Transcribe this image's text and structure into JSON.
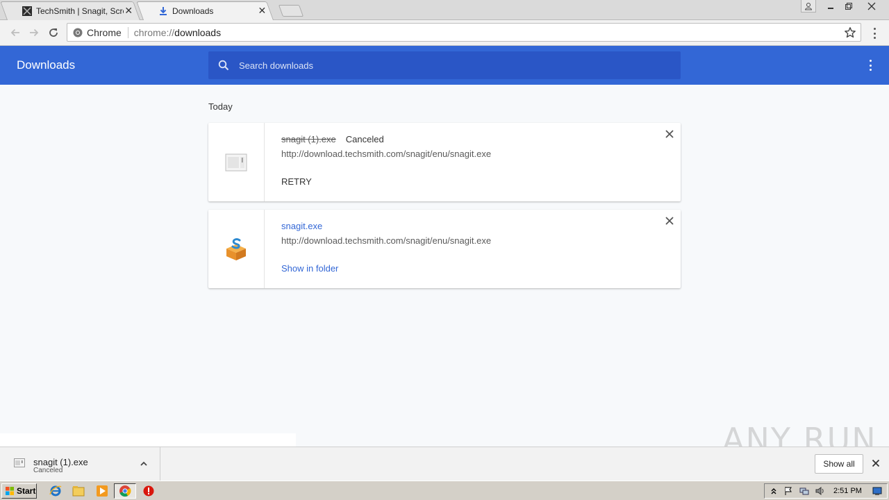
{
  "tabs": [
    {
      "title": "TechSmith | Snagit, Screen C",
      "active": false
    },
    {
      "title": "Downloads",
      "active": true
    }
  ],
  "toolbar": {
    "chip_label": "Chrome",
    "url_scheme": "chrome://",
    "url_host": "downloads"
  },
  "header": {
    "title": "Downloads",
    "search_placeholder": "Search downloads"
  },
  "section": {
    "label": "Today"
  },
  "downloads": [
    {
      "filename": "snagit (1).exe",
      "status": "Canceled",
      "url": "http://download.techsmith.com/snagit/enu/snagit.exe",
      "action": "RETRY"
    },
    {
      "filename": "snagit.exe",
      "status": "",
      "url": "http://download.techsmith.com/snagit/enu/snagit.exe",
      "action": "Show in folder"
    }
  ],
  "shelf": {
    "item_name": "snagit (1).exe",
    "item_status": "Canceled",
    "show_all": "Show all"
  },
  "watermark": "ANY RUN",
  "taskbar": {
    "start_label": "Start",
    "clock": "2:51 PM"
  },
  "colors": {
    "header_blue": "#3367d6",
    "search_blue": "#2a56c6",
    "link_blue": "#3367d6"
  }
}
